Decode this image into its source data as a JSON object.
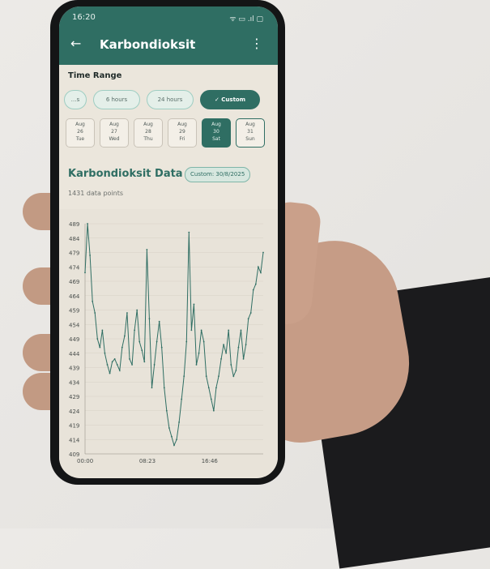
{
  "status_bar": {
    "time": "16:20",
    "icons": "ᯤ ▭ .ıl ▢"
  },
  "app_bar": {
    "title": "Karbondioksit"
  },
  "time_range": {
    "label": "Time Range",
    "options": [
      {
        "label": "…s",
        "selected": false
      },
      {
        "label": "6 hours",
        "selected": false
      },
      {
        "label": "24 hours",
        "selected": false
      },
      {
        "label": "Custom",
        "selected": true
      }
    ]
  },
  "days": [
    {
      "month": "Aug",
      "day": "26",
      "weekday": "Tue",
      "selected": false
    },
    {
      "month": "Aug",
      "day": "27",
      "weekday": "Wed",
      "selected": false
    },
    {
      "month": "Aug",
      "day": "28",
      "weekday": "Thu",
      "selected": false
    },
    {
      "month": "Aug",
      "day": "29",
      "weekday": "Fri",
      "selected": false
    },
    {
      "month": "Aug",
      "day": "30",
      "weekday": "Sat",
      "selected": true
    },
    {
      "month": "Aug",
      "day": "31",
      "weekday": "Sun",
      "selected": false
    }
  ],
  "data_section": {
    "title": "Karbondioksit Data",
    "badge": "Custom: 30/8/2025",
    "count": "1431 data points"
  },
  "chart_data": {
    "type": "line",
    "title": "",
    "xlabel": "",
    "ylabel": "",
    "ylim": [
      409,
      489
    ],
    "y_ticks": [
      409,
      414,
      419,
      424,
      429,
      434,
      439,
      444,
      449,
      454,
      459,
      464,
      469,
      474,
      479,
      484,
      489
    ],
    "x_ticks": [
      "00:00",
      "08:23",
      "16:46"
    ],
    "xlim_minutes": [
      0,
      1440
    ],
    "grid": true,
    "color": "#2f6e63",
    "series": [
      {
        "x": [
          0,
          20,
          40,
          60,
          80,
          100,
          120,
          140,
          160,
          180,
          200,
          220,
          240,
          260,
          280,
          300,
          320,
          340,
          360,
          380,
          400,
          420,
          440,
          460,
          480,
          500,
          520,
          540,
          560,
          580,
          600,
          620,
          640,
          660,
          680,
          700,
          720,
          740,
          760,
          780,
          800,
          820,
          840,
          860,
          880,
          900,
          920,
          940,
          960,
          980,
          1000,
          1020,
          1040,
          1060,
          1080,
          1100,
          1120,
          1140,
          1160,
          1180,
          1200,
          1220,
          1240,
          1260,
          1280,
          1300,
          1320,
          1340,
          1360,
          1380,
          1400,
          1420,
          1440
        ],
        "values": [
          472,
          489,
          478,
          462,
          458,
          449,
          446,
          452,
          444,
          440,
          437,
          441,
          442,
          440,
          438,
          446,
          450,
          458,
          442,
          440,
          452,
          459,
          448,
          445,
          441,
          480,
          456,
          432,
          440,
          448,
          455,
          446,
          432,
          424,
          418,
          415,
          412,
          414,
          420,
          428,
          436,
          448,
          486,
          452,
          461,
          440,
          444,
          452,
          448,
          436,
          432,
          428,
          424,
          432,
          436,
          442,
          447,
          444,
          452,
          440,
          436,
          438,
          446,
          452,
          442,
          447,
          456,
          458,
          466,
          468,
          474,
          472,
          479
        ]
      }
    ]
  }
}
